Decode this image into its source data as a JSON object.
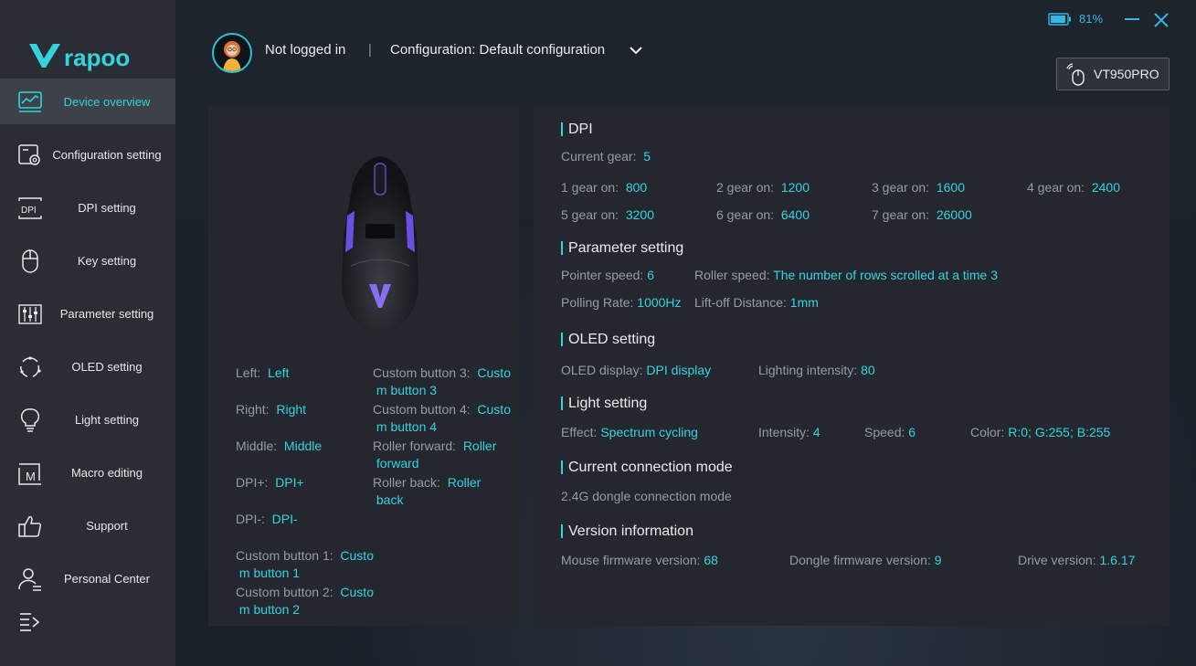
{
  "brand": {
    "logo_text": "rapoo",
    "accent": "#34d3e0"
  },
  "sidebar": {
    "items": [
      {
        "label": "Device overview",
        "icon": "monitor-chart-icon",
        "active": true
      },
      {
        "label": "Configuration setting",
        "icon": "config-gear-icon"
      },
      {
        "label": "DPI setting",
        "icon": "dpi-icon"
      },
      {
        "label": "Key setting",
        "icon": "mouse-icon"
      },
      {
        "label": "Parameter setting",
        "icon": "sliders-icon"
      },
      {
        "label": "OLED setting",
        "icon": "refresh-cycle-icon"
      },
      {
        "label": "Light setting",
        "icon": "light-bulb-icon"
      },
      {
        "label": "Macro editing",
        "icon": "macro-m-icon"
      },
      {
        "label": "Support",
        "icon": "thumbs-up-icon"
      },
      {
        "label": "Personal Center",
        "icon": "person-list-icon"
      }
    ]
  },
  "header": {
    "login_status": "Not logged in",
    "separator": "|",
    "configuration": "Configuration: Default configuration",
    "battery": "81%",
    "device": "VT950PRO"
  },
  "keys": {
    "left": {
      "k": "Left:",
      "v": "Left"
    },
    "right": {
      "k": "Right:",
      "v": "Right"
    },
    "middle": {
      "k": "Middle:",
      "v": "Middle"
    },
    "dpi_plus": {
      "k": "DPI+:",
      "v": "DPI+"
    },
    "dpi_minus": {
      "k": "DPI-:",
      "v": "DPI-"
    },
    "custom1": {
      "k": "Custom button 1:",
      "v1": "Custo",
      "v2": "m button 1"
    },
    "custom2": {
      "k": "Custom button 2:",
      "v1": "Custo",
      "v2": "m button 2"
    },
    "custom3": {
      "k": "Custom button 3:",
      "v1": "Custo",
      "v2": "m button 3"
    },
    "custom4": {
      "k": "Custom button 4:",
      "v1": "Custo",
      "v2": "m button 4"
    },
    "roller_forward": {
      "k": "Roller forward:",
      "v1": "Roller",
      "v2": "forward"
    },
    "roller_back": {
      "k": "Roller back:",
      "v1": "Roller",
      "v2": "back"
    }
  },
  "dpi": {
    "title": "DPI",
    "current_gear_label": "Current gear:",
    "current_gear": "5",
    "gears": [
      {
        "k": "1 gear on:",
        "v": "800"
      },
      {
        "k": "2 gear on:",
        "v": "1200"
      },
      {
        "k": "3 gear on:",
        "v": "1600"
      },
      {
        "k": "4 gear on:",
        "v": "2400"
      },
      {
        "k": "5 gear on:",
        "v": "3200"
      },
      {
        "k": "6 gear on:",
        "v": "6400"
      },
      {
        "k": "7 gear on:",
        "v": "26000"
      }
    ]
  },
  "parameter": {
    "title": "Parameter setting",
    "pointer_speed": {
      "k": "Pointer speed:",
      "v": "6"
    },
    "roller_speed": {
      "k": "Roller speed:",
      "v": "The number of rows scrolled at a time 3"
    },
    "polling_rate": {
      "k": "Polling Rate:",
      "v": "1000Hz"
    },
    "liftoff": {
      "k": "Lift-off Distance:",
      "v": "1mm"
    }
  },
  "oled": {
    "title": "OLED setting",
    "display": {
      "k": "OLED display:",
      "v": "DPI display"
    },
    "intensity": {
      "k": "Lighting intensity:",
      "v": "80"
    }
  },
  "light": {
    "title": "Light setting",
    "effect": {
      "k": "Effect:",
      "v": "Spectrum cycling"
    },
    "intensity": {
      "k": "Intensity:",
      "v": "4"
    },
    "speed": {
      "k": "Speed:",
      "v": "6"
    },
    "color": {
      "k": "Color:",
      "v": "R:0; G:255; B:255"
    }
  },
  "connection": {
    "title": "Current connection mode",
    "mode": "2.4G dongle connection mode"
  },
  "version": {
    "title": "Version information",
    "mouse": {
      "k": "Mouse firmware version:",
      "v": "68"
    },
    "dongle": {
      "k": "Dongle firmware version:",
      "v": "9"
    },
    "drive": {
      "k": "Drive version:",
      "v": "1.6.17"
    }
  }
}
